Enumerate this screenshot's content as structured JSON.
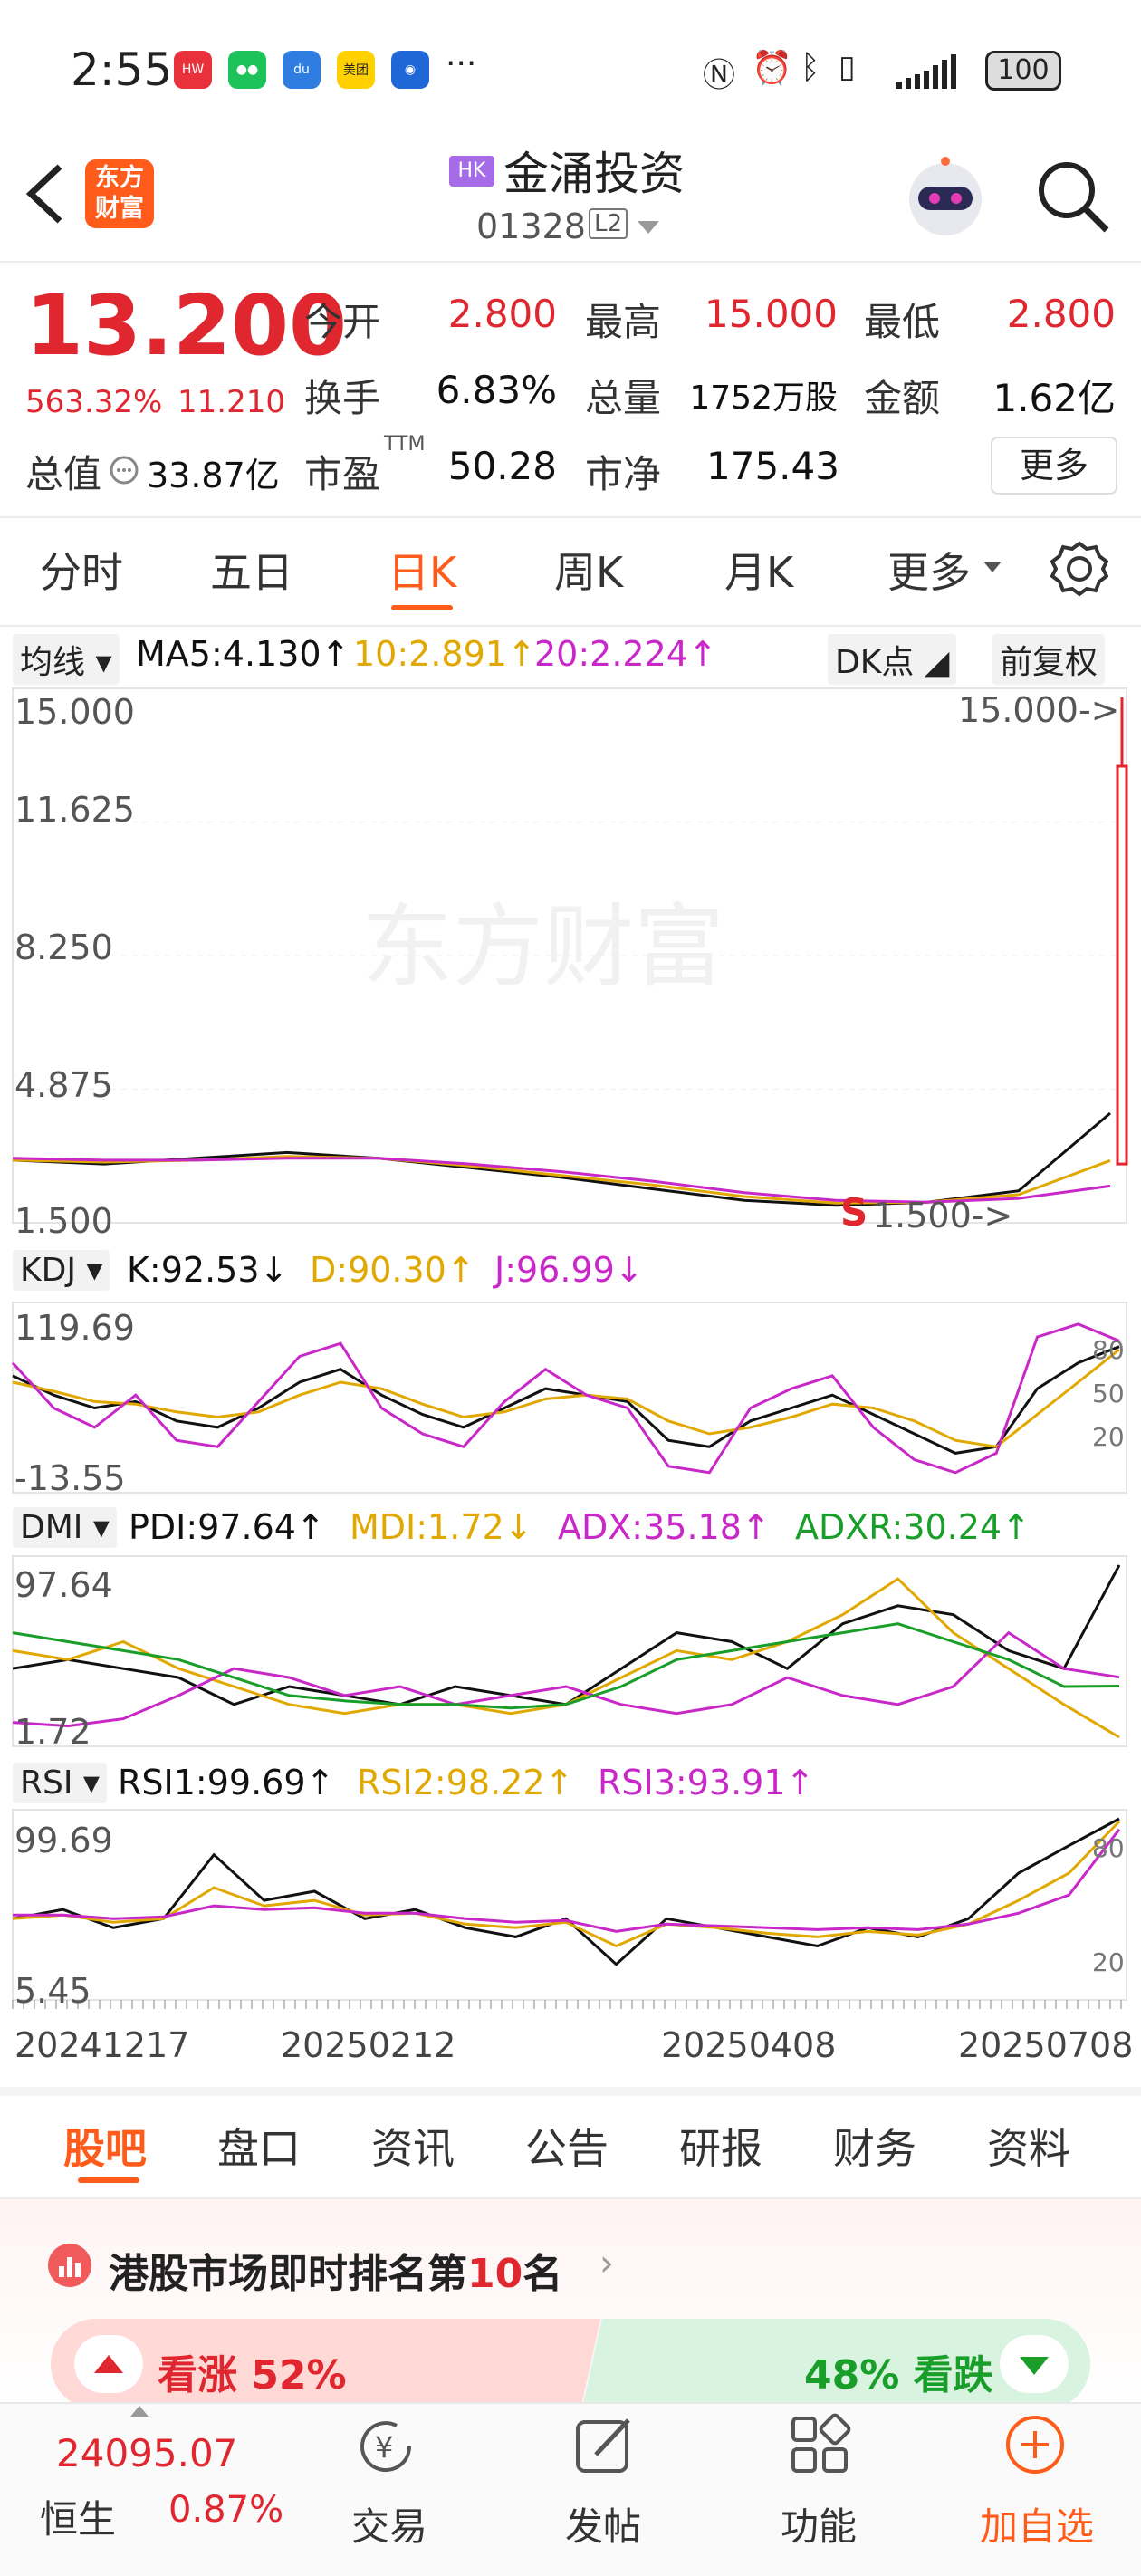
{
  "status_bar": {
    "time": "2:55",
    "more": "···",
    "battery": "100"
  },
  "header": {
    "logo_text_1": "东方",
    "logo_text_2": "财富",
    "market_badge": "HK",
    "stock_name": "金涌投资",
    "stock_code": "01328",
    "level_badge": "L2"
  },
  "quote": {
    "price": "13.200",
    "change_pct": "563.32%",
    "change": "11.210",
    "open_label": "今开",
    "open": "2.800",
    "high_label": "最高",
    "high": "15.000",
    "low_label": "最低",
    "low": "2.800",
    "turnover_label": "换手",
    "turnover": "6.83%",
    "volume_label": "总量",
    "volume": "1752万股",
    "amount_label": "金额",
    "amount": "1.62亿",
    "mktcap_label": "总值",
    "mktcap": "33.87亿",
    "pe_label": "市盈",
    "pe_sup": "TTM",
    "pe": "50.28",
    "pb_label": "市净",
    "pb": "175.43",
    "more_button": "更多"
  },
  "period_tabs": [
    "分时",
    "五日",
    "日K",
    "周K",
    "月K",
    "更多"
  ],
  "active_tab": "日K",
  "kline": {
    "ma_selector": "均线",
    "ma5": "MA5:4.130↑",
    "ma10": "10:2.891↑",
    "ma20": "20:2.224↑",
    "dk_button": "DK点",
    "adjust_button": "前复权",
    "y_ticks": [
      "15.000",
      "11.625",
      "8.250",
      "4.875",
      "1.500"
    ],
    "max_marker": "15.000->",
    "min_marker": "1.500->",
    "watermark": "东方财富"
  },
  "kdj": {
    "selector": "KDJ",
    "k": "K:92.53↓",
    "d": "D:90.30↑",
    "j": "J:96.99↓",
    "y_top": "119.69",
    "y_bottom": "-13.55",
    "levels": [
      "80",
      "50",
      "20"
    ]
  },
  "dmi": {
    "selector": "DMI",
    "pdi": "PDI:97.64↑",
    "mdi": "MDI:1.72↓",
    "adx": "ADX:35.18↑",
    "adxr": "ADXR:30.24↑",
    "y_top": "97.64",
    "y_bottom": "1.72"
  },
  "rsi": {
    "selector": "RSI",
    "rsi1": "RSI1:99.69↑",
    "rsi2": "RSI2:98.22↑",
    "rsi3": "RSI3:93.91↑",
    "y_top": "99.69",
    "y_bottom": "5.45",
    "levels": [
      "80",
      "20"
    ]
  },
  "x_dates": [
    "20241217",
    "20250212",
    "20250408",
    "20250708"
  ],
  "bottom_tabs": [
    "股吧",
    "盘口",
    "资讯",
    "公告",
    "研报",
    "财务",
    "资料"
  ],
  "active_bottom_tab": "股吧",
  "ranking": {
    "prefix": "港股市场即时排名第",
    "rank": "10",
    "suffix": "名"
  },
  "sentiment": {
    "up_label": "看涨 52%",
    "down_label": "48% 看跌",
    "up_pct": 52
  },
  "bottom_nav": {
    "index_value": "24095.07",
    "index_name": "恒生",
    "index_change": "0.87%",
    "trade": "交易",
    "post": "发帖",
    "functions": "功能",
    "add_watch": "加自选"
  },
  "colors": {
    "up": "#e0262e",
    "accent": "#ff5b1a",
    "k_line": "#111111",
    "d_line": "#e0a800",
    "j_line": "#c828c8",
    "adxr_line": "#1a9e2a"
  },
  "chart_data": [
    {
      "type": "line",
      "title": "",
      "ylim": [
        1.5,
        15.0
      ],
      "x": [
        "20241217",
        "20250212",
        "20250408",
        "20250708"
      ],
      "series": [
        {
          "name": "MA5",
          "values": [
            2.9,
            2.8,
            2.95,
            3.1,
            2.95,
            2.7,
            2.45,
            2.15,
            1.85,
            1.72,
            1.8,
            2.1,
            4.13
          ]
        },
        {
          "name": "10",
          "values": [
            2.9,
            2.85,
            2.9,
            3.0,
            2.95,
            2.75,
            2.5,
            2.25,
            1.95,
            1.78,
            1.8,
            2.0,
            2.891
          ]
        },
        {
          "name": "20",
          "values": [
            2.95,
            2.9,
            2.9,
            2.95,
            2.95,
            2.8,
            2.6,
            2.35,
            2.05,
            1.85,
            1.8,
            1.9,
            2.224
          ]
        }
      ],
      "last_candle": {
        "open": 2.8,
        "high": 15.0,
        "low": 2.8,
        "close": 13.2
      }
    },
    {
      "type": "line",
      "ylim": [
        -13.55,
        119.69
      ],
      "series": [
        {
          "name": "K",
          "values": [
            70,
            55,
            45,
            50,
            35,
            30,
            45,
            65,
            75,
            55,
            40,
            30,
            45,
            60,
            55,
            50,
            20,
            15,
            35,
            45,
            55,
            40,
            25,
            10,
            15,
            60,
            80,
            92.53
          ]
        },
        {
          "name": "D",
          "values": [
            65,
            58,
            50,
            48,
            42,
            38,
            42,
            55,
            65,
            60,
            48,
            38,
            42,
            52,
            55,
            52,
            35,
            25,
            30,
            38,
            48,
            45,
            35,
            20,
            15,
            40,
            65,
            90.3
          ]
        },
        {
          "name": "J",
          "values": [
            80,
            45,
            30,
            55,
            20,
            15,
            50,
            85,
            95,
            45,
            25,
            15,
            50,
            75,
            55,
            45,
            0,
            -5,
            45,
            60,
            70,
            30,
            5,
            -5,
            10,
            100,
            110,
            96.99
          ]
        }
      ]
    },
    {
      "type": "line",
      "ylim": [
        1.72,
        97.64
      ],
      "series": [
        {
          "name": "PDI",
          "values": [
            40,
            45,
            40,
            35,
            20,
            30,
            25,
            20,
            30,
            25,
            20,
            40,
            60,
            55,
            40,
            65,
            75,
            70,
            50,
            40,
            97.64
          ]
        },
        {
          "name": "MDI",
          "values": [
            50,
            45,
            55,
            40,
            30,
            20,
            15,
            20,
            20,
            15,
            20,
            35,
            50,
            45,
            55,
            70,
            90,
            60,
            40,
            20,
            1.72
          ]
        },
        {
          "name": "ADX",
          "values": [
            10,
            8,
            12,
            25,
            40,
            35,
            25,
            30,
            20,
            25,
            30,
            20,
            15,
            20,
            35,
            25,
            20,
            30,
            60,
            40,
            35.18
          ]
        },
        {
          "name": "ADXR",
          "values": [
            60,
            55,
            50,
            45,
            35,
            25,
            22,
            20,
            20,
            18,
            20,
            30,
            45,
            50,
            55,
            60,
            65,
            55,
            45,
            30,
            30.24
          ]
        }
      ]
    },
    {
      "type": "line",
      "ylim": [
        5.45,
        99.69
      ],
      "series": [
        {
          "name": "RSI1",
          "values": [
            45,
            50,
            40,
            45,
            80,
            55,
            60,
            45,
            50,
            40,
            35,
            45,
            20,
            45,
            40,
            35,
            30,
            40,
            35,
            45,
            70,
            85,
            99.69
          ]
        },
        {
          "name": "RSI2",
          "values": [
            45,
            47,
            43,
            45,
            62,
            52,
            55,
            47,
            48,
            42,
            40,
            43,
            30,
            42,
            40,
            37,
            35,
            38,
            36,
            42,
            55,
            70,
            98.22
          ]
        },
        {
          "name": "RSI3",
          "values": [
            47,
            47,
            45,
            46,
            52,
            50,
            51,
            48,
            48,
            45,
            43,
            44,
            38,
            42,
            41,
            40,
            39,
            40,
            39,
            42,
            48,
            58,
            93.91
          ]
        }
      ]
    }
  ]
}
